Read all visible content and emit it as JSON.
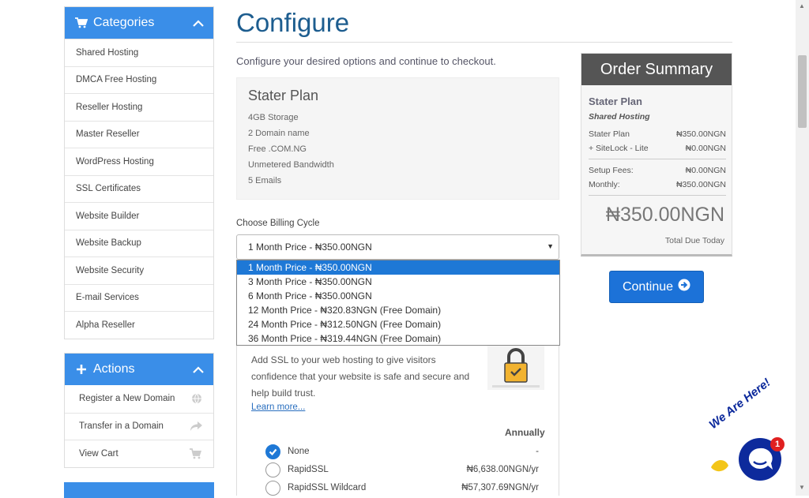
{
  "sidebar": {
    "categories_title": "Categories",
    "categories": [
      "Shared Hosting",
      "DMCA Free Hosting",
      "Reseller Hosting",
      "Master Reseller",
      "WordPress Hosting",
      "SSL Certificates",
      "Website Builder",
      "Website Backup",
      "Website Security",
      "E-mail Services",
      "Alpha Reseller"
    ],
    "actions_title": "Actions",
    "actions": [
      {
        "label": "Register a New Domain",
        "icon": "globe-icon"
      },
      {
        "label": "Transfer in a Domain",
        "icon": "share-arrow-icon"
      },
      {
        "label": "View Cart",
        "icon": "cart-icon"
      }
    ]
  },
  "main": {
    "title": "Configure",
    "subtitle": "Configure your desired options and continue to checkout.",
    "plan": {
      "name": "Stater Plan",
      "features": [
        "4GB Storage",
        "2 Domain name",
        "Free .COM.NG",
        "Unmetered Bandwidth",
        "5 Emails"
      ]
    },
    "billing": {
      "label": "Choose Billing Cycle",
      "selected": "1 Month Price - ₦350.00NGN",
      "options": [
        "1 Month Price - ₦350.00NGN",
        "3 Month Price - ₦350.00NGN",
        "6 Month Price - ₦350.00NGN",
        "12 Month Price - ₦320.83NGN (Free Domain)",
        "24 Month Price - ₦312.50NGN (Free Domain)",
        "36 Month Price - ₦319.44NGN (Free Domain)"
      ]
    },
    "ssl": {
      "description": "Add SSL to your web hosting to give visitors confidence that your website is safe and secure and help build trust.",
      "learn_more": "Learn more...",
      "column_header": "Annually",
      "options": [
        {
          "label": "None",
          "price": "-",
          "checked": true
        },
        {
          "label": "RapidSSL",
          "price": "₦6,638.00NGN/yr",
          "checked": false
        },
        {
          "label": "RapidSSL Wildcard",
          "price": "₦57,307.69NGN/yr",
          "checked": false
        }
      ]
    }
  },
  "summary": {
    "title": "Order Summary",
    "plan_name": "Stater Plan",
    "group": "Shared Hosting",
    "lines": [
      {
        "label": "Stater Plan",
        "value": "₦350.00NGN"
      },
      {
        "label": "+ SiteLock - Lite",
        "value": "₦0.00NGN"
      }
    ],
    "fees": [
      {
        "label": "Setup Fees:",
        "value": "₦0.00NGN"
      },
      {
        "label": "Monthly:",
        "value": "₦350.00NGN"
      }
    ],
    "total": "₦350.00NGN",
    "total_label": "Total Due Today"
  },
  "continue_label": "Continue",
  "chat": {
    "tagline": "We Are Here!",
    "badge": "1"
  },
  "colors": {
    "accent": "#3a8ee8",
    "primary_button": "#1c72d8",
    "title": "#1d5d8f",
    "summary_header": "#555555",
    "chat": "#0d2a9c"
  }
}
